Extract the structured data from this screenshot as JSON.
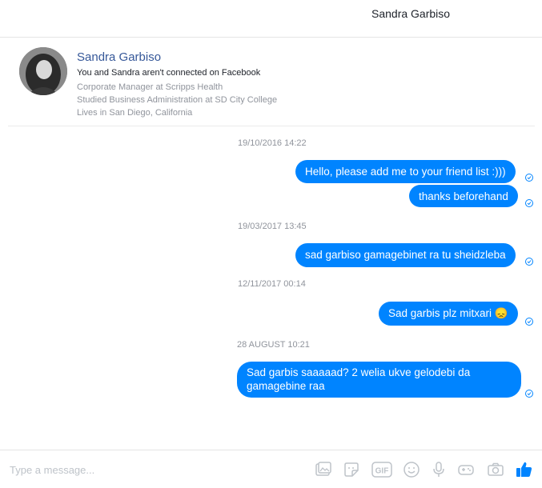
{
  "header": {
    "title": "Sandra Garbiso"
  },
  "profile": {
    "name": "Sandra Garbiso",
    "connection": "You and Sandra aren't connected on Facebook",
    "work": "Corporate Manager at Scripps Health",
    "education": "Studied Business Administration at SD City College",
    "location": "Lives in San Diego, California"
  },
  "conversation": [
    {
      "timestamp": "19/10/2016 14:22",
      "messages": [
        "Hello, please add me to your friend list :)))",
        "thanks beforehand"
      ]
    },
    {
      "timestamp": "19/03/2017 13:45",
      "messages": [
        "sad garbiso gamagebinet ra tu sheidzleba"
      ]
    },
    {
      "timestamp": "12/11/2017 00:14",
      "messages": [
        "Sad garbis plz mitxari 😞"
      ]
    },
    {
      "timestamp": "28 AUGUST 10:21",
      "messages": [
        "Sad garbis saaaaad? 2 welia ukve gelodebi da gamagebine raa"
      ]
    }
  ],
  "composer": {
    "placeholder": "Type a message..."
  },
  "colors": {
    "accent": "#0084ff",
    "link": "#365899",
    "muted": "#90949c"
  },
  "toolbar_icons": [
    "photo-icon",
    "sticker-icon",
    "gif-icon",
    "emoji-icon",
    "microphone-icon",
    "game-icon",
    "camera-icon",
    "like-icon"
  ]
}
